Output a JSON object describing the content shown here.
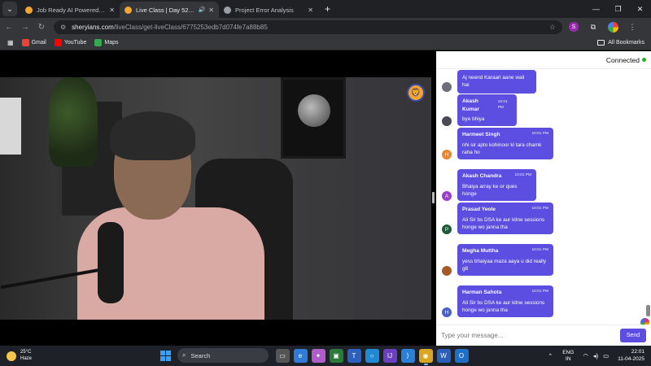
{
  "browser": {
    "tabs": [
      {
        "title": "Job Ready AI Powered Cohort: W",
        "active": false
      },
      {
        "title": "Live Class | Day 52 - String",
        "active": true
      },
      {
        "title": "Project Error Analysis",
        "active": false
      }
    ],
    "new_tab_label": "+",
    "url_domain": "sheryians.com",
    "url_path": "/liveClass/get-liveClass/6775253edb7d074fe7a88b85",
    "bookmarks": [
      {
        "label": "Gmail",
        "color": "#ea4335"
      },
      {
        "label": "YouTube",
        "color": "#ff0000"
      },
      {
        "label": "Maps",
        "color": "#34a853"
      }
    ],
    "all_bookmarks_label": "All Bookmarks",
    "extension_badge": "S"
  },
  "chat": {
    "status": "Connected",
    "status_color": "#1db31d",
    "messages": [
      {
        "name": "",
        "time": "",
        "text": "Aj neend Karaari aane wali hai",
        "avatar": "",
        "avatar_color": "#6d6d7a"
      },
      {
        "name": "Akash Kumar",
        "time": "10:01 PM",
        "text": "bye bhiya",
        "avatar": "",
        "avatar_color": "#4a4a55"
      },
      {
        "name": "Harmeet Singh",
        "time": "10:01 PM",
        "text": "nhi sir apto kohinoor ki tara chamk raha ho",
        "avatar": "H",
        "avatar_color": "#e8852e"
      },
      {
        "name": "Akash Chandra",
        "time": "10:01 PM",
        "text": "Bhaiya array ke or ques honge",
        "avatar": "A",
        "avatar_color": "#9b3fc9"
      },
      {
        "name": "Prasad Yeole",
        "time": "10:01 PM",
        "text": "Ali Sir bs DSA ke aur kitne sessions honge wo janna tha",
        "avatar": "P",
        "avatar_color": "#1a5b3a"
      },
      {
        "name": "Megha Muttha",
        "time": "10:01 PM",
        "text": "yess bhaiyaa maza aaya u did really g8",
        "avatar": "",
        "avatar_color": "#a55a2a"
      },
      {
        "name": "Harman Sahota",
        "time": "10:01 PM",
        "text": "Ali Sir bs DSA ke aur kitne sessions honge wo janna tha",
        "avatar": "H",
        "avatar_color": "#4a5fc9"
      }
    ],
    "input_placeholder": "Type your message...",
    "send_label": "Send",
    "accent_color": "#5b4ee0"
  },
  "taskbar": {
    "temperature": "25°C",
    "weather": "Haze",
    "search_label": "Search",
    "lang_top": "ENG",
    "lang_bottom": "IN",
    "time": "22:01",
    "date": "11-04-2025",
    "notification_count": "2"
  }
}
